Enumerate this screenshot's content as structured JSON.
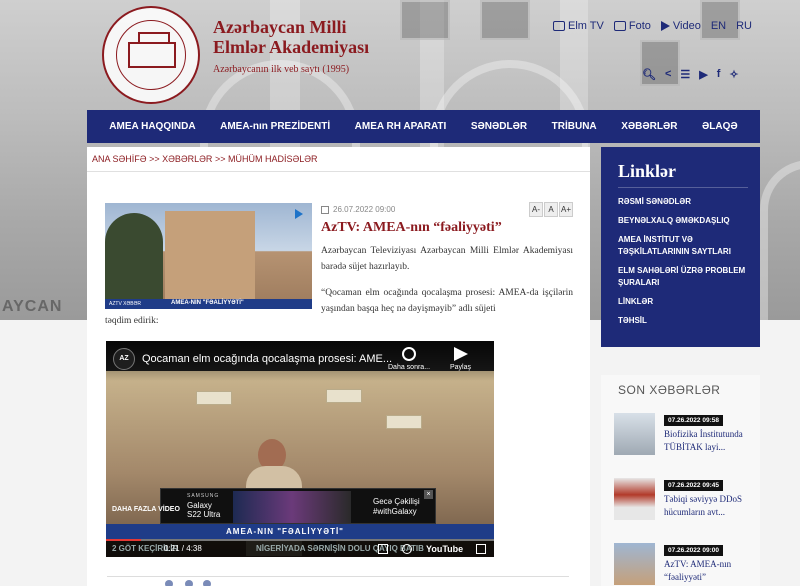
{
  "header": {
    "title_line1": "Azərbaycan Milli",
    "title_line2": "Elmlər Akademiyası",
    "subtitle": "Azərbaycanın ilk veb saytı (1995)",
    "top_links": [
      {
        "label": "Elm TV",
        "icon": "tv-icon"
      },
      {
        "label": "Foto",
        "icon": "photo-icon"
      },
      {
        "label": "Video",
        "icon": "video-icon"
      },
      {
        "label": "EN",
        "icon": ""
      },
      {
        "label": "RU",
        "icon": ""
      }
    ],
    "social": [
      "search-icon",
      "share-icon",
      "sitemap-icon",
      "youtube-icon",
      "facebook-icon",
      "twitter-icon"
    ],
    "bg_lettering": "AYCAN"
  },
  "nav": {
    "items": [
      "AMEA HAQQINDA",
      "AMEA-nın PREZİDENTİ",
      "AMEA RH APARATI",
      "SƏNƏDLƏR",
      "TRİBUNA",
      "XƏBƏRLƏR",
      "ƏLAQƏ"
    ]
  },
  "breadcrumb": {
    "home": "ANA SƏHİFƏ",
    "sep": ">>",
    "level2": "XƏBƏRLƏR",
    "level3": "MÜHÜM HADİSƏLƏR"
  },
  "article": {
    "date": "26.07.2022 09:00",
    "font_sizes": [
      "A-",
      "A",
      "A+"
    ],
    "title": "AzTV: AMEA-nın “fəaliyyəti”",
    "para1": "Azərbaycan Televiziyası Azərbaycan Milli Elmlər Akademiyası barədə süjet hazırlayıb.",
    "para2_a": "“Qocaman elm ocağında qocalaşma prosesi: AMEA-da işçilərin yaşından başqa heç nə dəyişməyib” adlı süjeti",
    "para2_b": "təqdim edirik:",
    "thumb_tag": "AZTV XƏBƏR",
    "thumb_caption": "AMEA-NIN \"FƏALİYYƏTİ\""
  },
  "video": {
    "channel": "AZ",
    "title": "Qocaman elm ocağında qocalaşma prosesi: AME...",
    "later_label": "Daha sonra...",
    "share_label": "Paylaş",
    "ad_brand": "SAMSUNG",
    "ad_product_line1": "Galaxy",
    "ad_product_line2": "S22 Ultra",
    "ad_cta_line1": "Gecə Çəkilişi",
    "ad_cta_line2": "#withGalaxy",
    "ad_close": "×",
    "more_videos": "DAHA FAZLA VİDEO",
    "lower_third": "AMEA-NIN \"FƏALİYYƏTİ\"",
    "ticker_left": "2 GÖT KEÇİRİLİR",
    "time": "0:21 / 4:38",
    "ticker_right": "NİGERİYADA SƏRNİŞİN DOLU QAYIQ BATIB",
    "youtube": "YouTube",
    "progress_fraction": 0.09
  },
  "sidebar": {
    "links_heading": "Linklər",
    "links": [
      "RƏSMİ SƏNƏDLƏR",
      "BEYNƏLXALQ ƏMƏKDAŞLIQ",
      "AMEA İNSTİTUT VƏ TƏŞKİLATLARININ SAYTLARI",
      "ELM SAHƏLƏRİ ÜZRƏ PROBLEM ŞURALARI",
      "LİNKLƏR",
      "TƏHSİL"
    ],
    "news_heading": "SON XƏBƏRLƏR",
    "news": [
      {
        "date": "07.26.2022 09:58",
        "title": "Biofizika İnstitutunda TÜBİTAK layi..."
      },
      {
        "date": "07.26.2022 09:45",
        "title": "Təbiqi səviyyə DDoS hücumların avt..."
      },
      {
        "date": "07.26.2022 09:00",
        "title": "AzTV: AMEA-nın “fəaliyyəti”"
      }
    ]
  }
}
